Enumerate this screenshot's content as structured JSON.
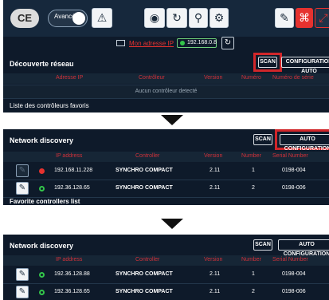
{
  "panel1": {
    "logo": "CE",
    "mode_label": "Avancé",
    "toolbar_icons": [
      "warning-icon",
      "eye-icon",
      "sync-icon",
      "wrench-icon",
      "gears-icon",
      "pen-icon",
      "network-icon",
      "expand-icon"
    ],
    "address_link": "Mon adresse IP",
    "ip": "192.168.0.8",
    "section_title": "Découverte réseau",
    "scan_label": "SCAN",
    "auto_config_label": "CONFIGURATION AUTO",
    "columns": [
      "Adresse IP",
      "Contrôleur",
      "Version",
      "Numéro",
      "Numéro de série"
    ],
    "empty_message": "Aucun contrôleur detecté",
    "favorites_title": "Liste des contrôleurs favoris"
  },
  "panel2": {
    "section_title": "Network discovery",
    "scan_label": "SCAN",
    "auto_config_label": "AUTO CONFIGURATION",
    "columns": [
      "IP address",
      "Controller",
      "Version",
      "Number",
      "Serial Number"
    ],
    "rows": [
      {
        "status": "red",
        "checked": false,
        "ip": "192.168.11.228",
        "controller": "SYNCHRO COMPACT",
        "version": "2.11",
        "number": "1",
        "serial": "0198-004"
      },
      {
        "status": "green",
        "checked": true,
        "ip": "192.36.128.65",
        "controller": "SYNCHRO COMPACT",
        "version": "2.11",
        "number": "2",
        "serial": "0198-006"
      }
    ],
    "favorites_title": "Favorite controllers list"
  },
  "panel3": {
    "section_title": "Network discovery",
    "scan_label": "SCAN",
    "auto_config_label": "AUTO CONFIGURATION",
    "columns": [
      "IP address",
      "Controller",
      "Version",
      "Number",
      "Serial Number"
    ],
    "rows": [
      {
        "status": "green",
        "checked": true,
        "ip": "192.36.128.88",
        "controller": "SYNCHRO COMPACT",
        "version": "2.11",
        "number": "1",
        "serial": "0198-004"
      },
      {
        "status": "green",
        "checked": true,
        "ip": "192.36.128.65",
        "controller": "SYNCHRO COMPACT",
        "version": "2.11",
        "number": "2",
        "serial": "0198-006"
      }
    ]
  },
  "colors": {
    "accent_red": "#e6322f",
    "panel_bg": "#0e1a2a",
    "status_green": "#33c54a"
  }
}
